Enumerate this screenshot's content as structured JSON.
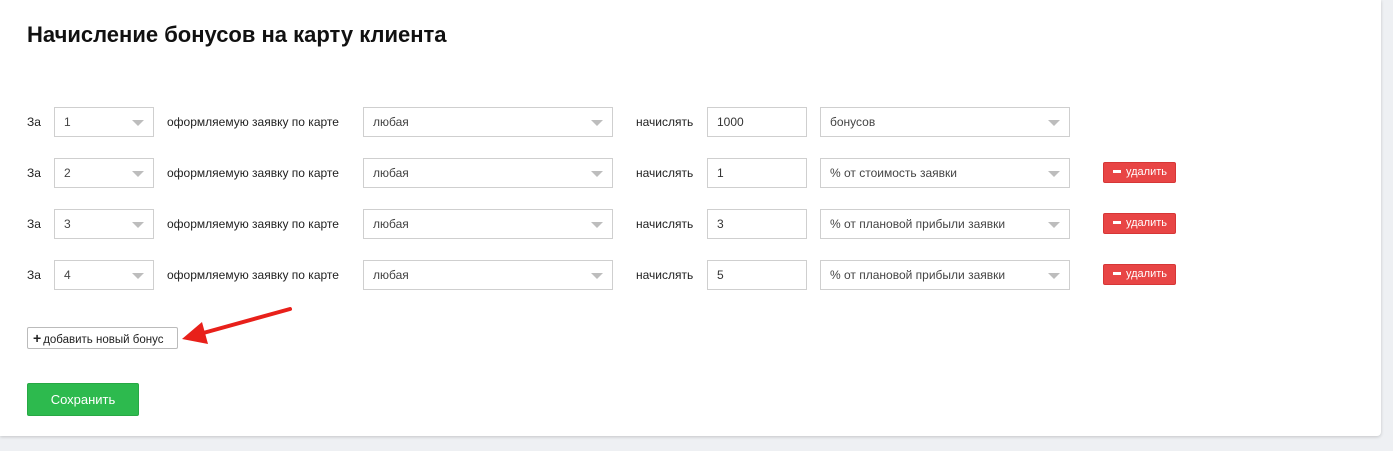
{
  "page": {
    "title": "Начисление бонусов на карту клиента"
  },
  "labels": {
    "for": "За",
    "application": "оформляемую заявку по карте",
    "accrue": "начислять"
  },
  "rows": [
    {
      "number": "1",
      "card": "любая",
      "amount": "1000",
      "unit": "бонусов",
      "delete_label": ""
    },
    {
      "number": "2",
      "card": "любая",
      "amount": "1",
      "unit": "% от стоимость заявки",
      "delete_label": "удалить"
    },
    {
      "number": "3",
      "card": "любая",
      "amount": "3",
      "unit": "% от плановой прибыли заявки",
      "delete_label": "удалить"
    },
    {
      "number": "4",
      "card": "любая",
      "amount": "5",
      "unit": "% от плановой прибыли заявки",
      "delete_label": "удалить"
    }
  ],
  "actions": {
    "add_label": "добавить новый бонус",
    "save_label": "Сохранить"
  },
  "colors": {
    "delete": "#e84545",
    "save": "#2dba4e",
    "annotation_arrow": "#e8201a"
  },
  "icons": {
    "select_caret": "chevron-down-icon",
    "delete": "minus-icon",
    "add": "plus-icon",
    "annotation": "arrow-annotation-icon"
  }
}
